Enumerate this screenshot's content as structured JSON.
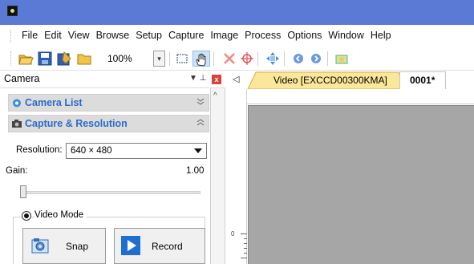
{
  "menu": [
    "File",
    "Edit",
    "View",
    "Browse",
    "Setup",
    "Capture",
    "Image",
    "Process",
    "Options",
    "Window",
    "Help"
  ],
  "toolbar": {
    "zoom_value": "100%",
    "icons": [
      "open-folder-icon",
      "save-icon",
      "batch-save-icon",
      "folder-icon",
      "zoom-dropdown",
      "select-rect-icon",
      "hand-pan-icon",
      "delete-icon",
      "crosshair-icon",
      "move-icon",
      "back-icon",
      "forward-icon",
      "snapshot-icon"
    ]
  },
  "panel": {
    "title": "Camera",
    "pin_glyph": "▼ ⊥",
    "close_glyph": "x"
  },
  "sections": {
    "camera_list": "Camera List",
    "capture_resolution": "Capture & Resolution"
  },
  "capture": {
    "resolution_label": "Resolution:",
    "resolution_value": "640 × 480",
    "gain_label": "Gain:",
    "gain_value": "1.00",
    "gain_level": 0.0,
    "mode_label": "Video Mode",
    "snap_label": "Snap",
    "record_label": "Record"
  },
  "tabs": {
    "scroll_glyph": "◁",
    "video_tab": "Video [EXCCD00300KMA]",
    "image_tab": "0001*"
  },
  "colors": {
    "titlebar": "#5b7ad6",
    "video_tab": "#fbe79a",
    "section_label": "#2d6bc7",
    "canvas": "#a6a6a6"
  }
}
